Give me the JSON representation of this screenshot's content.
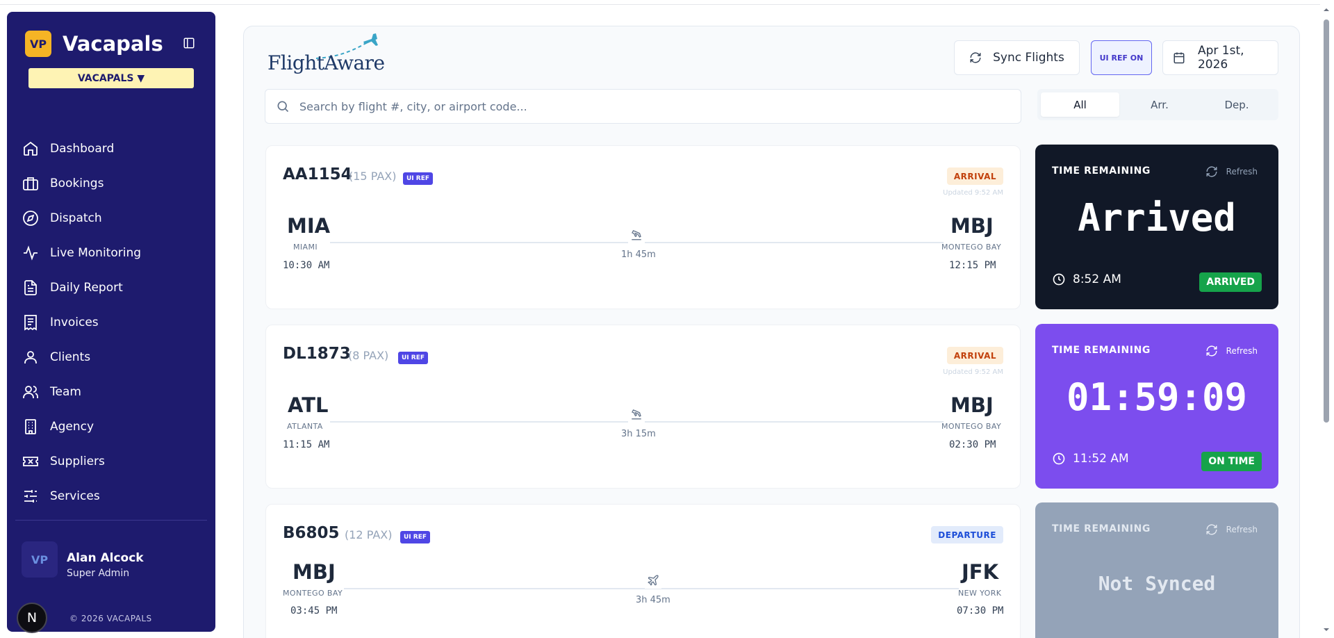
{
  "sidebar": {
    "brand_logo": "VP",
    "brand_name": "Vacapals",
    "org_selector": "VACAPALS ▼",
    "items": [
      {
        "label": "Dashboard",
        "icon": "home-icon"
      },
      {
        "label": "Bookings",
        "icon": "briefcase-icon"
      },
      {
        "label": "Dispatch",
        "icon": "compass-icon"
      },
      {
        "label": "Live Monitoring",
        "icon": "activity-icon"
      },
      {
        "label": "Daily Report",
        "icon": "file-text-icon"
      },
      {
        "label": "Invoices",
        "icon": "receipt-icon"
      },
      {
        "label": "Clients",
        "icon": "user-icon"
      },
      {
        "label": "Team",
        "icon": "users-icon"
      },
      {
        "label": "Agency",
        "icon": "building-icon"
      },
      {
        "label": "Suppliers",
        "icon": "ticket-icon"
      },
      {
        "label": "Services",
        "icon": "sliders-icon"
      }
    ],
    "user": {
      "avatar": "VP",
      "name": "Alan Alcock",
      "role": "Super Admin"
    },
    "n_badge": "N",
    "copyright": "© 2026 VACAPALS"
  },
  "header": {
    "logo_text": "FlightAware",
    "sync_label": "Sync Flights",
    "uiref_label": "UI REF ON",
    "date_label": "Apr 1st, 2026"
  },
  "search": {
    "placeholder": "Search by flight #, city, or airport code..."
  },
  "filters": [
    {
      "label": "All",
      "active": true
    },
    {
      "label": "Arr.",
      "active": false
    },
    {
      "label": "Dep.",
      "active": false
    }
  ],
  "flights": [
    {
      "code": "AA1154",
      "pax": "(15 PAX)",
      "tag": "UI REF",
      "type": "ARRIVAL",
      "updated": "Updated 9:52 AM",
      "origin": {
        "code": "MIA",
        "city": "MIAMI",
        "time": "10:30 AM"
      },
      "destination": {
        "code": "MBJ",
        "city": "MONTEGO BAY",
        "time": "12:15 PM"
      },
      "duration": "1h 45m"
    },
    {
      "code": "DL1873",
      "pax": "(8 PAX)",
      "tag": "UI REF",
      "type": "ARRIVAL",
      "updated": "Updated 9:52 AM",
      "origin": {
        "code": "ATL",
        "city": "ATLANTA",
        "time": "11:15 AM"
      },
      "destination": {
        "code": "MBJ",
        "city": "MONTEGO BAY",
        "time": "02:30 PM"
      },
      "duration": "3h 15m"
    },
    {
      "code": "B6805",
      "pax": "(12 PAX)",
      "tag": "UI REF",
      "type": "DEPARTURE",
      "origin": {
        "code": "MBJ",
        "city": "MONTEGO BAY",
        "time": "03:45 PM"
      },
      "destination": {
        "code": "JFK",
        "city": "NEW YORK",
        "time": "07:30 PM"
      },
      "duration": "3h 45m"
    }
  ],
  "timers": [
    {
      "label": "TIME REMAINING",
      "refresh": "Refresh",
      "value": "Arrived",
      "clock": "8:52 AM",
      "status": "ARRIVED",
      "bg": "#111827"
    },
    {
      "label": "TIME REMAINING",
      "refresh": "Refresh",
      "value": "01:59:09",
      "clock": "11:52 AM",
      "status": "ON TIME",
      "bg": "#7c4dee"
    },
    {
      "label": "TIME REMAINING",
      "refresh": "Refresh",
      "value": "Not Synced",
      "bg": "#94a3b8"
    }
  ],
  "colors": {
    "sidebar_bg": "#1e1b6e",
    "brand_accent": "#f5b425",
    "uiref_tag": "#4f46e5",
    "status_green": "#16a34a",
    "arrival_badge": "#fdeed9",
    "departure_badge": "#e2ebfb"
  }
}
